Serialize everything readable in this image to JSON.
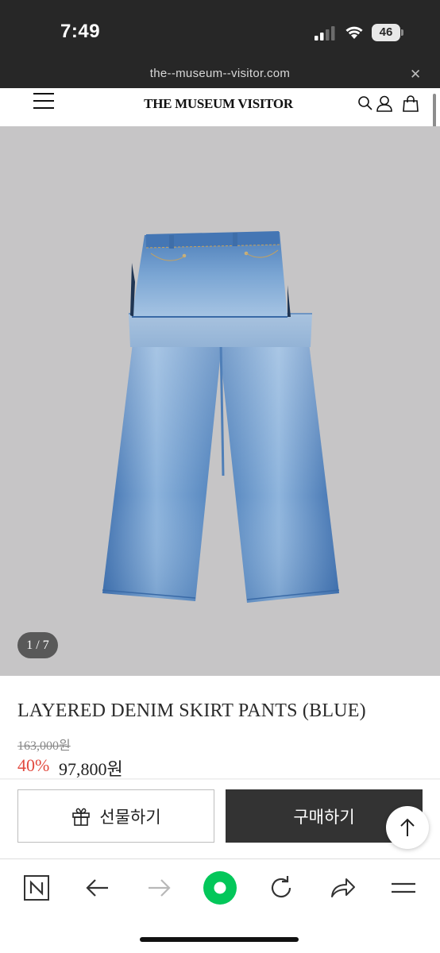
{
  "status_bar": {
    "time": "7:49",
    "battery": "46"
  },
  "browser": {
    "url": "the--museum--visitor.com",
    "close_icon": "close-icon"
  },
  "site_header": {
    "title": "THE MUSEUM VISITOR",
    "icons": [
      "menu-icon",
      "search-icon",
      "user-icon",
      "shopping-bag-icon"
    ]
  },
  "product": {
    "image_description_icon": "denim-pants-image",
    "image_counter": "1 / 7",
    "name": "LAYERED DENIM SKIRT PANTS (BLUE)",
    "original_price": "163,000원",
    "discount_rate": "40%",
    "sale_price": "97,800원"
  },
  "actions": {
    "gift_label": "선물하기",
    "buy_label": "구매하기",
    "gift_icon": "gift-icon",
    "scroll_top_icon": "arrow-up-icon"
  },
  "browser_toolbar": {
    "icons": [
      "naver-n-icon",
      "back-arrow-icon",
      "forward-arrow-icon",
      "green-home-icon",
      "refresh-icon",
      "share-icon",
      "menu-lines-icon"
    ],
    "accent_color": "#03c75a"
  },
  "colors": {
    "status_bar_bg": "#272727",
    "discount": "#e24a3f",
    "buy_button_bg": "#333333",
    "image_bg": "#c6c5c6"
  }
}
